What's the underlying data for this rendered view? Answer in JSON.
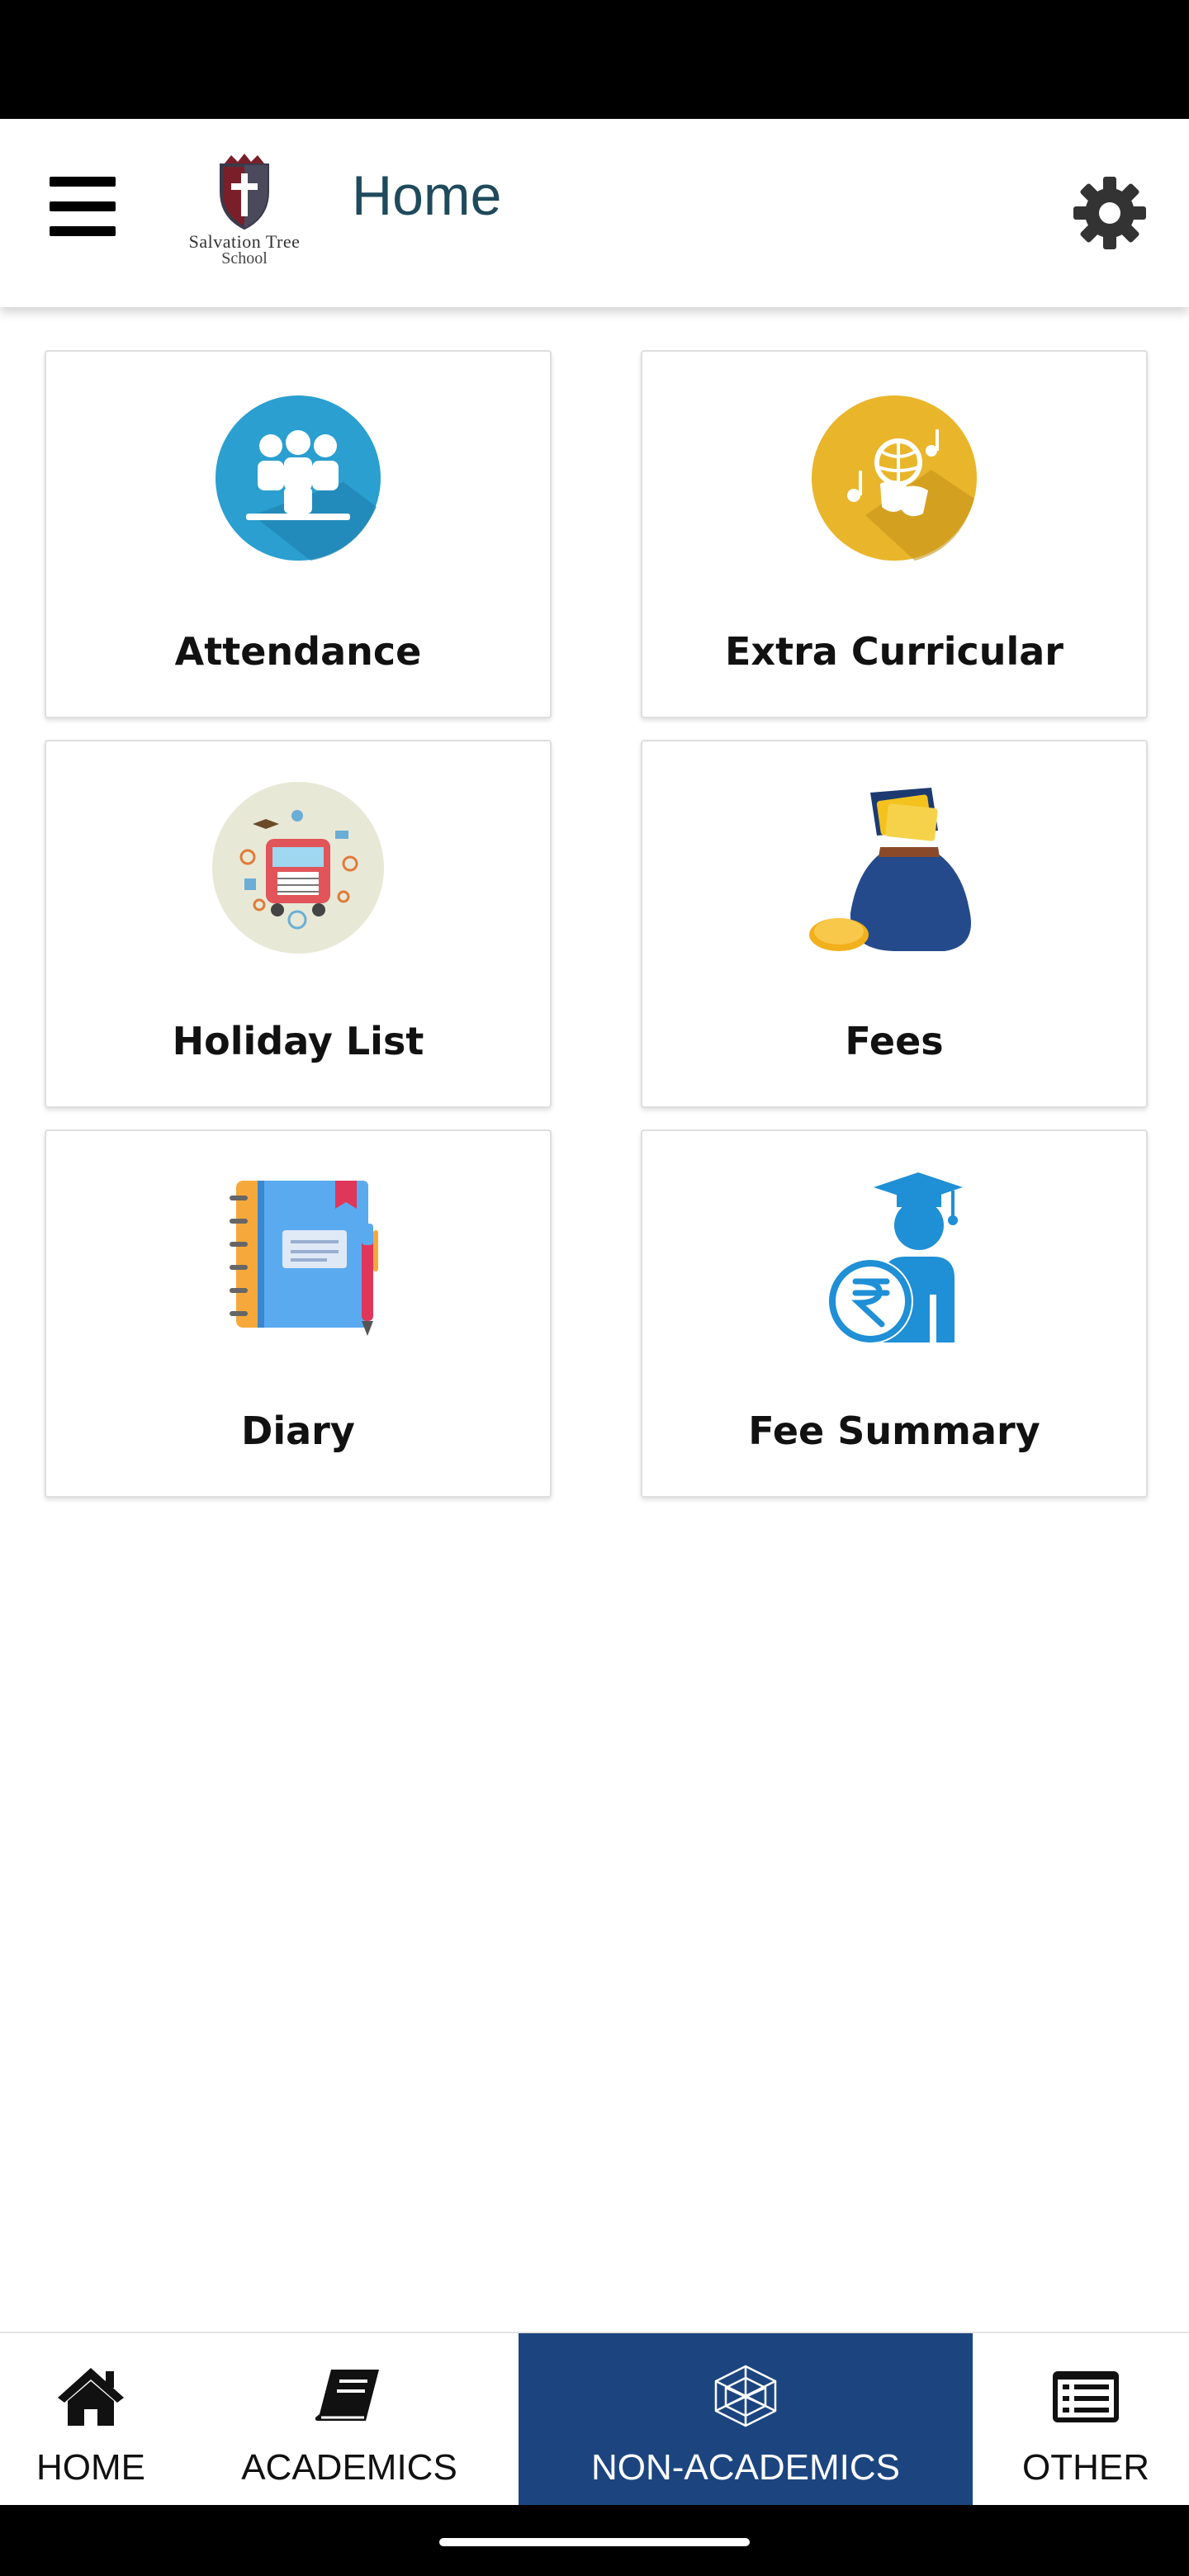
{
  "app_bar": {
    "title": "Home",
    "logo_line1": "Salvation Tree",
    "logo_line2": "School"
  },
  "tiles": [
    {
      "label": "Attendance",
      "icon": "attendance-icon",
      "color": "#2a9fd0"
    },
    {
      "label": "Extra Curricular",
      "icon": "extra-curricular-icon",
      "color": "#e9b52a"
    },
    {
      "label": "Holiday List",
      "icon": "holiday-list-icon",
      "color": "#e8e8d6"
    },
    {
      "label": "Fees",
      "icon": "money-bag-icon",
      "color": "#254a8c"
    },
    {
      "label": "Diary",
      "icon": "diary-icon",
      "color": "#5aaaf0"
    },
    {
      "label": "Fee Summary",
      "icon": "fee-summary-icon",
      "color": "#1f8fd6"
    }
  ],
  "bottom_nav": {
    "items": [
      {
        "label": "HOME",
        "icon": "home-icon"
      },
      {
        "label": "ACADEMICS",
        "icon": "book-icon"
      },
      {
        "label": "NON-ACADEMICS",
        "icon": "network-icon",
        "active": true
      },
      {
        "label": "OTHER",
        "icon": "list-icon"
      }
    ],
    "active_color": "#1c4580"
  }
}
